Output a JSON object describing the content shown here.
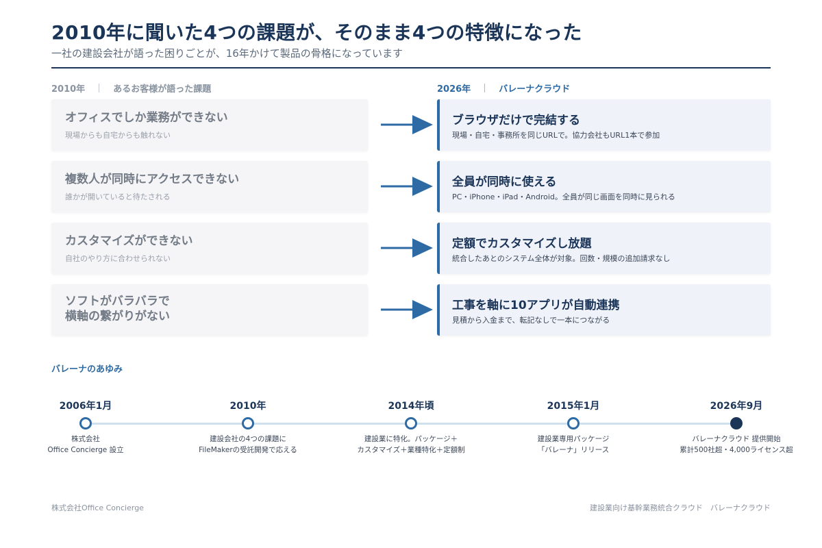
{
  "header": {
    "title": "2010年に聞いた4つの課題が、そのまま4つの特徴になった",
    "subtitle": "一社の建設会社が語った困りごとが、16年かけて製品の骨格になっています"
  },
  "columns": {
    "left_year": "2010年",
    "left_label": "あるお客様が語った課題",
    "right_year": "2026年",
    "right_label": "バレーナクラウド"
  },
  "problems": [
    {
      "title": "オフィスでしか業務ができない",
      "desc": "現場からも自宅からも触れない"
    },
    {
      "title": "複数人が同時にアクセスできない",
      "desc": "誰かが開いていると待たされる"
    },
    {
      "title": "カスタマイズができない",
      "desc": "自社のやり方に合わせられない"
    },
    {
      "title": "ソフトがバラバラで",
      "title2": "横軸の繋がりがない"
    }
  ],
  "features": [
    {
      "title": "ブラウザだけで完結する",
      "desc": "現場・自宅・事務所を同じURLで。協力会社もURL1本で参加"
    },
    {
      "title": "全員が同時に使える",
      "desc": "PC・iPhone・iPad・Android。全員が同じ画面を同時に見られる"
    },
    {
      "title": "定額でカスタマイズし放題",
      "desc": "統合したあとのシステム全体が対象。回数・規模の追加請求なし"
    },
    {
      "title": "工事を軸に10アプリが自動連携",
      "desc": "見積から入金まで、転記なしで一本につながる"
    }
  ],
  "timeline": {
    "heading": "バレーナのあゆみ",
    "items": [
      {
        "year": "2006年1月",
        "line1": "株式会社",
        "line2": "Office Concierge 設立"
      },
      {
        "year": "2010年",
        "line1": "建設会社の4つの課題に",
        "line2": "FileMakerの受託開発で応える"
      },
      {
        "year": "2014年頃",
        "line1": "建設業に特化。パッケージ＋",
        "line2": "カスタマイズ＋業種特化＋定額制"
      },
      {
        "year": "2015年1月",
        "line1": "建設業専用パッケージ",
        "line2": "「バレーナ」リリース"
      },
      {
        "year": "2026年9月",
        "line1": "バレーナクラウド 提供開始",
        "line2": "累計500社超・4,000ライセンス超"
      }
    ]
  },
  "footer": {
    "left": "株式会社Office Concierge",
    "right": "建設業向け基幹業務統合クラウド　バレーナクラウド"
  },
  "colors": {
    "navy": "#1b3558",
    "accent": "#2e6aa3",
    "muted": "#8a93a0"
  },
  "icons": {
    "arrow": "right-arrow-icon",
    "milestone": "circle-dot-icon"
  }
}
